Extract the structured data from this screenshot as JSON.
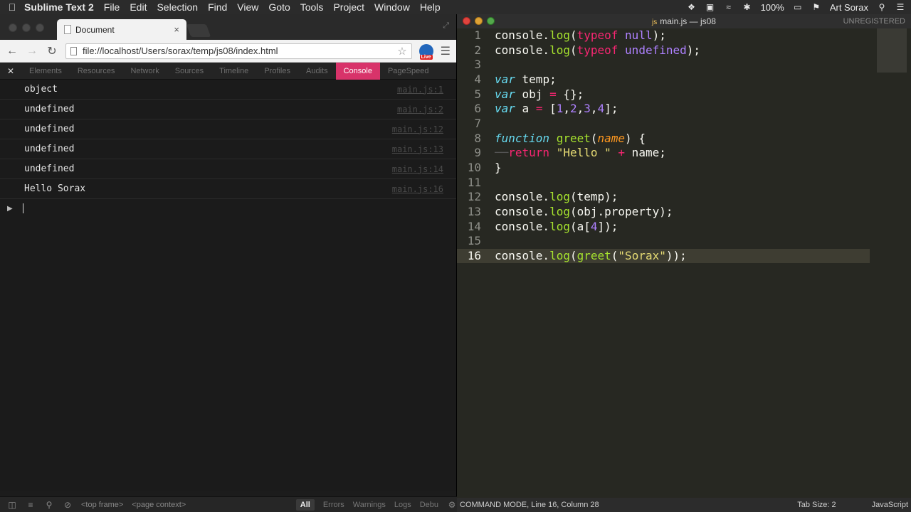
{
  "menubar": {
    "app_name": "Sublime Text 2",
    "items": [
      "File",
      "Edit",
      "Selection",
      "Find",
      "View",
      "Goto",
      "Tools",
      "Project",
      "Window",
      "Help"
    ],
    "battery": "100%",
    "user": "Art Sorax"
  },
  "chrome": {
    "tab_title": "Document",
    "tab_close": "×",
    "url": "file://localhost/Users/sorax/temp/js08/index.html",
    "live_badge": "Live",
    "devtools_tabs": [
      "Elements",
      "Resources",
      "Network",
      "Sources",
      "Timeline",
      "Profiles",
      "Audits",
      "Console",
      "PageSpeed"
    ],
    "active_tab": "Console",
    "console_rows": [
      {
        "msg": "object",
        "src": "main.js:1"
      },
      {
        "msg": "undefined",
        "src": "main.js:2"
      },
      {
        "msg": "undefined",
        "src": "main.js:12"
      },
      {
        "msg": "undefined",
        "src": "main.js:13"
      },
      {
        "msg": "undefined",
        "src": "main.js:14"
      },
      {
        "msg": "Hello Sorax",
        "src": "main.js:16"
      }
    ],
    "status": {
      "frame": "<top frame>",
      "context": "<page context>",
      "filters": [
        "All",
        "Errors",
        "Warnings",
        "Logs",
        "Debu"
      ]
    }
  },
  "sublime": {
    "title": "main.js — js08",
    "file_icon": "js",
    "unregistered": "UNREGISTERED",
    "current_line": 16,
    "status_mode": "COMMAND MODE, Line 16, Column 28",
    "tab_size": "Tab Size: 2",
    "syntax": "JavaScript",
    "line_numbers": [
      "1",
      "2",
      "3",
      "4",
      "5",
      "6",
      "7",
      "8",
      "9",
      "10",
      "11",
      "12",
      "13",
      "14",
      "15",
      "16"
    ]
  }
}
